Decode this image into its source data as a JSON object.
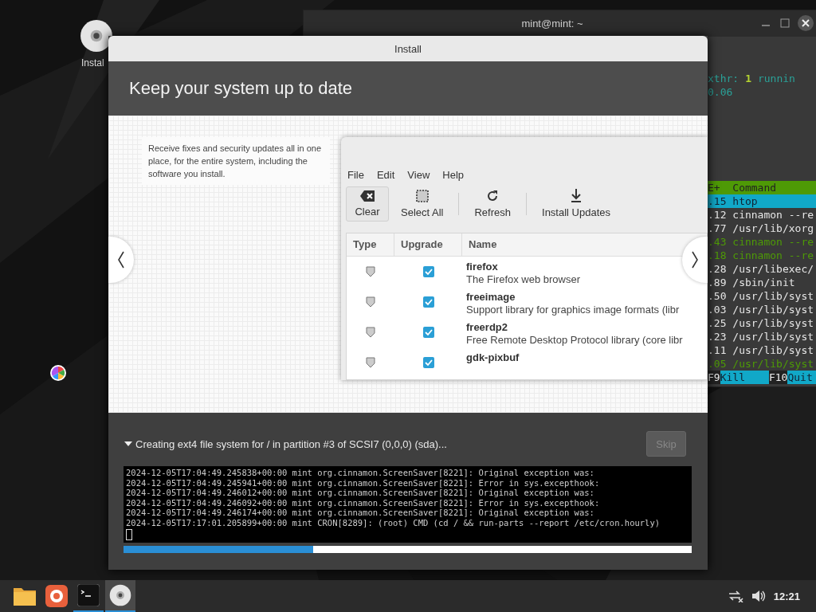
{
  "desktop": {
    "icons": [
      {
        "label": "Instal"
      }
    ]
  },
  "terminal_window": {
    "title": "mint@mint: ~",
    "tasks_line": {
      "label": "xthr:",
      "count": "1",
      "suffix": "runnin"
    },
    "load": "0.06",
    "header": "E+  Command",
    "rows": [
      {
        "text": ".15 htop",
        "kind": "process",
        "selected": true
      },
      {
        "text": ".12 cinnamon --re",
        "kind": "process",
        "selected": false
      },
      {
        "text": ".77 /usr/lib/xorg",
        "kind": "process",
        "selected": false
      },
      {
        "text": ".43 cinnamon --re",
        "kind": "thread",
        "selected": false
      },
      {
        "text": ".18 cinnamon --re",
        "kind": "thread",
        "selected": false
      },
      {
        "text": ".28 /usr/libexec/",
        "kind": "process",
        "selected": false
      },
      {
        "text": ".89 /sbin/init",
        "kind": "process",
        "selected": false
      },
      {
        "text": ".50 /usr/lib/syst",
        "kind": "process",
        "selected": false
      },
      {
        "text": ".03 /usr/lib/syst",
        "kind": "process",
        "selected": false
      },
      {
        "text": ".25 /usr/lib/syst",
        "kind": "process",
        "selected": false
      },
      {
        "text": ".23 /usr/lib/syst",
        "kind": "process",
        "selected": false
      },
      {
        "text": ".11 /usr/lib/syst",
        "kind": "process",
        "selected": false
      },
      {
        "text": ".05 /usr/lib/syst",
        "kind": "thread",
        "selected": false
      }
    ],
    "function_keys": [
      {
        "key": "F9",
        "action": "Kill"
      },
      {
        "key": "F10",
        "action": "Quit"
      }
    ]
  },
  "install_window": {
    "title": "Install",
    "heading": "Keep your system up to date",
    "slide": {
      "caption": "Receive fixes and security updates all in one place, for the entire system, including the software you install.",
      "screenshot": {
        "menu": [
          "File",
          "Edit",
          "View",
          "Help"
        ],
        "toolbar": [
          {
            "kind": "clear",
            "label": "Clear",
            "pressed": true
          },
          {
            "kind": "select-all",
            "label": "Select All",
            "pressed": false
          },
          {
            "kind": "refresh",
            "label": "Refresh",
            "pressed": false
          },
          {
            "kind": "download",
            "label": "Install Updates",
            "pressed": false
          }
        ],
        "columns": [
          "Type",
          "Upgrade",
          "Name"
        ],
        "rows": [
          {
            "name": "firefox",
            "description": "The Firefox web browser",
            "checked": true
          },
          {
            "name": "freeimage",
            "description": "Support library for graphics image formats (libr",
            "checked": true
          },
          {
            "name": "freerdp2",
            "description": "Free Remote Desktop Protocol library (core libr",
            "checked": true
          },
          {
            "name": "gdk-pixbuf",
            "checked": true
          }
        ]
      }
    },
    "status": {
      "text": "Creating ext4 file system for / in partition #3 of SCSI7 (0,0,0) (sda)...",
      "expanded": true
    },
    "skip": {
      "label": "Skip",
      "disabled": true
    },
    "log": [
      "2024-12-05T17:04:49.245838+00:00 mint org.cinnamon.ScreenSaver[8221]: Original exception was:",
      "2024-12-05T17:04:49.245941+00:00 mint org.cinnamon.ScreenSaver[8221]: Error in sys.excepthook:",
      "2024-12-05T17:04:49.246012+00:00 mint org.cinnamon.ScreenSaver[8221]: Original exception was:",
      "2024-12-05T17:04:49.246092+00:00 mint org.cinnamon.ScreenSaver[8221]: Error in sys.excepthook:",
      "2024-12-05T17:04:49.246174+00:00 mint org.cinnamon.ScreenSaver[8221]: Original exception was:",
      "2024-12-05T17:17:01.205899+00:00 mint CRON[8289]: (root) CMD (cd / && run-parts --report /etc/cron.hourly)"
    ],
    "progress": {
      "level": 0.334
    }
  },
  "taskbar": {
    "apps": [
      {
        "kind": "folder",
        "running": false,
        "focused": false
      },
      {
        "kind": "browser",
        "running": false,
        "focused": false
      },
      {
        "kind": "terminal",
        "running": true,
        "focused": false
      },
      {
        "kind": "disc",
        "running": true,
        "focused": true
      }
    ],
    "clock": "12:21"
  }
}
